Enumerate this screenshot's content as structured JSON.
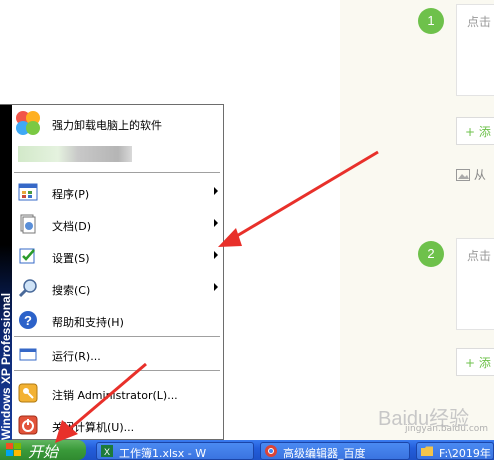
{
  "editor": {
    "step1": "1",
    "step2": "2",
    "placeholder1": "点击",
    "placeholder2": "点击",
    "add1": "+ 添",
    "add2": "+ 添",
    "image_insert": "从"
  },
  "start_menu": {
    "side_text": "Windows XP Professional",
    "pinned": "强力卸载电脑上的软件",
    "items": [
      {
        "label": "程序(P)"
      },
      {
        "label": "文档(D)"
      },
      {
        "label": "设置(S)"
      },
      {
        "label": "搜索(C)"
      },
      {
        "label": "帮助和支持(H)"
      },
      {
        "label": "运行(R)..."
      },
      {
        "label": "注销 Administrator(L)..."
      },
      {
        "label": "关闭计算机(U)..."
      }
    ]
  },
  "taskbar": {
    "start_label": "开始",
    "tasks": [
      {
        "label": "工作簿1.xlsx - W"
      },
      {
        "label": "高级编辑器_百度"
      },
      {
        "label": "F:\\2019年"
      }
    ]
  },
  "watermark": {
    "text": "Baidu经验",
    "url": "jingyan.baidu.com"
  },
  "colors": {
    "accent_green": "#6ec14b",
    "arrow_red": "#e8302a",
    "taskbar_blue": "#245edb",
    "start_green": "#3a9a3a"
  }
}
